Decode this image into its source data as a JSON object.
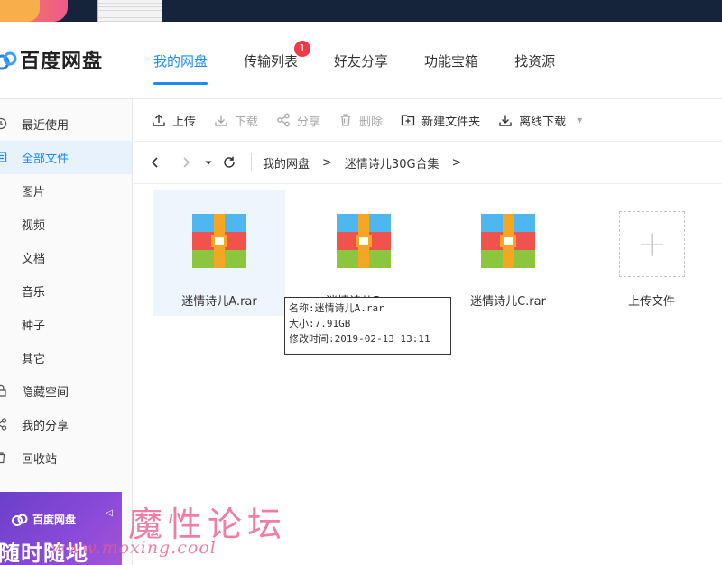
{
  "app": {
    "title": "百度网盘"
  },
  "nav": {
    "tabs": [
      {
        "label": "我的网盘",
        "active": true
      },
      {
        "label": "传输列表",
        "badge": "1"
      },
      {
        "label": "好友分享"
      },
      {
        "label": "功能宝箱"
      },
      {
        "label": "找资源"
      }
    ]
  },
  "sidebar": {
    "items": [
      {
        "label": "最近使用",
        "icon": "clock-icon"
      },
      {
        "label": "全部文件",
        "icon": "folder-icon",
        "active": true
      },
      {
        "label": "图片"
      },
      {
        "label": "视频"
      },
      {
        "label": "文档"
      },
      {
        "label": "音乐"
      },
      {
        "label": "种子"
      },
      {
        "label": "其它"
      },
      {
        "label": "隐藏空间",
        "icon": "lock-icon"
      },
      {
        "label": "我的分享",
        "icon": "share-icon"
      },
      {
        "label": "回收站",
        "icon": "trash-icon"
      }
    ],
    "promo": {
      "brand": "百度网盘",
      "slogan": "随时随地"
    }
  },
  "toolbar": {
    "upload": "上传",
    "download": "下载",
    "share": "分享",
    "delete": "删除",
    "new_folder": "新建文件夹",
    "offline_download": "离线下载"
  },
  "breadcrumb": {
    "items": [
      "我的网盘",
      "迷情诗儿30G合集"
    ],
    "separator": ">"
  },
  "files": [
    {
      "name": "迷情诗儿A.rar",
      "selected": true
    },
    {
      "name": "迷情诗儿B.rar"
    },
    {
      "name": "迷情诗儿C.rar"
    }
  ],
  "upload_tile": {
    "label": "上传文件"
  },
  "tooltip": {
    "name_line": "名称:迷情诗儿A.rar",
    "size_line": "大小:7.91GB",
    "modified_line": "修改时间:2019-02-13 13:11"
  },
  "watermark": {
    "text": "魔性论坛",
    "url": "www.moxing.cool"
  },
  "colors": {
    "accent": "#1a8cff",
    "badge": "#f2394a",
    "promo": "#7a44d0"
  }
}
